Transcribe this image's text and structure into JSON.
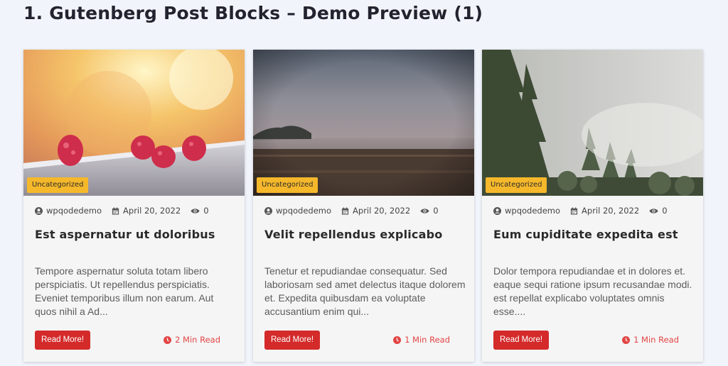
{
  "page": {
    "title": "1. Gutenberg Post Blocks – Demo Preview (1)"
  },
  "posts": [
    {
      "category": "Uncategorized",
      "author": "wpqodedemo",
      "date": "April 20, 2022",
      "views": "0",
      "title": "Est aspernatur ut doloribus",
      "excerpt": "Tempore aspernatur soluta totam libero perspiciatis. Ut repellendus perspiciatis. Eveniet temporibus illum non earum. Aut quos nihil a Ad...",
      "read_more": "Read More!",
      "read_time": "2 Min Read",
      "image": "raspberries-photo"
    },
    {
      "category": "Uncategorized",
      "author": "wpqodedemo",
      "date": "April 20, 2022",
      "views": "0",
      "title": "Velit repellendus explicabo",
      "excerpt": "Tenetur et repudiandae consequatur. Sed laboriosam sed amet delectus itaque dolorem et. Expedita quibusdam ea voluptate accusantium enim qui...",
      "read_more": "Read More!",
      "read_time": "1 Min Read",
      "image": "misty-field-photo"
    },
    {
      "category": "Uncategorized",
      "author": "wpqodedemo",
      "date": "April 20, 2022",
      "views": "0",
      "title": "Eum cupiditate expedita est",
      "excerpt": "Dolor tempora repudiandae et in dolores et. eaque sequi ratione ipsum recusandae modi. est repellat explicabo voluptates omnis esse....",
      "read_more": "Read More!",
      "read_time": "1 Min Read",
      "image": "foggy-forest-photo"
    }
  ],
  "colors": {
    "badge": "#f5b82b",
    "button": "#d42a2a",
    "read_time": "#e34545",
    "background": "#f1f5fb"
  },
  "icons": {
    "author": "user-circle-icon",
    "date": "calendar-icon",
    "views": "eye-icon",
    "read_time": "clock-icon"
  }
}
